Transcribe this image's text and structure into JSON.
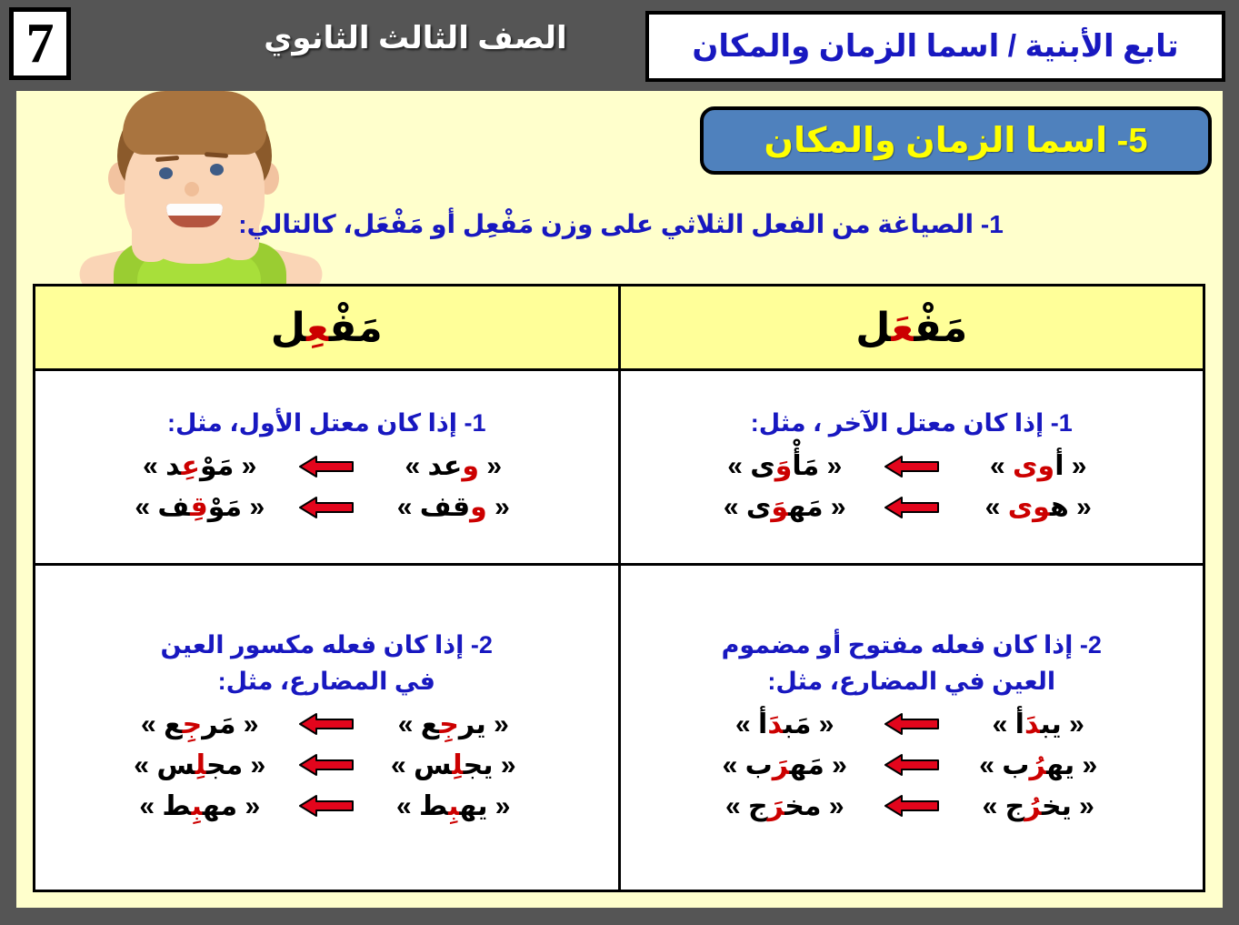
{
  "topbar": {
    "page_number": "7",
    "grade_label": "الصف الثالث الثانوي",
    "header_title": "تابع الأبنية / اسما الزمان والمكان"
  },
  "banner": {
    "label": "5- اسما الزمان والمكان",
    "bg_color": "#4F81BD",
    "text_color": "#FFFF00"
  },
  "subtitle": "1- الصياغة من الفعل الثلاثي على وزن مَفْعِل أو مَفْعَل، كالتالي:",
  "table": {
    "headers": {
      "right": "مَفْعِل",
      "left": "مَفْعَل"
    },
    "rows": [
      {
        "right": {
          "rule": "1- إذا كان معتل الأول، مثل:",
          "examples": [
            {
              "derived": "« مَوْعِد »",
              "source": "« وعد »"
            },
            {
              "derived": "« مَوْقِف »",
              "source": "« وقف »"
            }
          ]
        },
        "left": {
          "rule": "1- إذا كان معتل الآخر ، مثل:",
          "examples": [
            {
              "derived": "« مَأْوَى »",
              "source": "« أوى »"
            },
            {
              "derived": "« مَهوَى »",
              "source": "« هوى »"
            }
          ]
        }
      },
      {
        "right": {
          "rule_line1": "2- إذا كان فعله مكسور العين",
          "rule_line2": "في المضارع، مثل:",
          "examples": [
            {
              "derived": "« مَرجِع »",
              "source": "« يرجِع »"
            },
            {
              "derived": "« مجلِس »",
              "source": "« يجلِس »"
            },
            {
              "derived": "« مهبِط »",
              "source": "« يهبِط »"
            }
          ]
        },
        "left": {
          "rule_line1": "2- إذا كان فعله مفتوح أو مضموم",
          "rule_line2": "العين في المضارع، مثل:",
          "examples": [
            {
              "derived": "« مَبدَأ »",
              "source": "« يبدَأ »"
            },
            {
              "derived": "« مَهرَب »",
              "source": "« يهرُب »"
            },
            {
              "derived": "« مخرَج »",
              "source": "« يخرُج »"
            }
          ]
        }
      }
    ]
  },
  "colors": {
    "slide_bg": "#FFFFCC",
    "outer_bg": "#555555",
    "header_row_bg": "#FFFF99",
    "rule_text": "#1818C0",
    "accent_red": "#CC0000",
    "arrow_red": "#E3051C"
  }
}
